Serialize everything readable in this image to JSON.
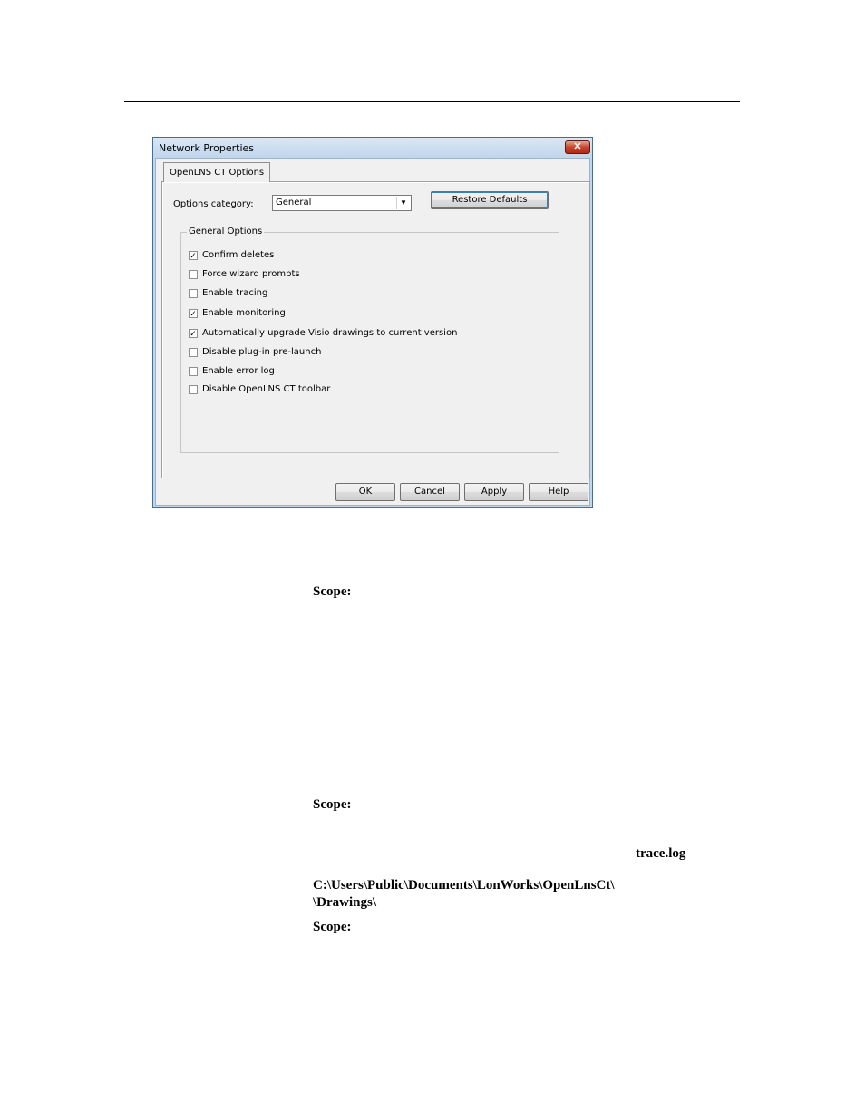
{
  "dialog": {
    "title": "Network Properties",
    "close_symbol": "✕",
    "tab_label": "OpenLNS CT Options",
    "options_category_label": "Options category:",
    "options_category_value": "General",
    "dropdown_arrow": "▼",
    "restore_defaults_label": "Restore Defaults",
    "group_title": "General Options",
    "checkboxes": [
      {
        "label": "Confirm deletes",
        "checked": true,
        "mark": "✓"
      },
      {
        "label": "Force wizard prompts",
        "checked": false,
        "mark": ""
      },
      {
        "label": "Enable tracing",
        "checked": false,
        "mark": ""
      },
      {
        "label": "Enable monitoring",
        "checked": true,
        "mark": "✓"
      },
      {
        "label": "Automatically upgrade Visio drawings to current version",
        "checked": true,
        "mark": "✓"
      },
      {
        "label": "Disable plug-in pre-launch",
        "checked": false,
        "mark": ""
      },
      {
        "label": "Enable error log",
        "checked": false,
        "mark": ""
      },
      {
        "label": "Disable OpenLNS CT toolbar",
        "checked": false,
        "mark": ""
      }
    ],
    "buttons": {
      "ok": "OK",
      "cancel": "Cancel",
      "apply": "Apply",
      "help": "Help"
    }
  },
  "document": {
    "scope_1": "Scope:",
    "scope_2": "Scope:",
    "trace_log": "trace.log",
    "path_line_1": "C:\\Users\\Public\\Documents\\LonWorks\\OpenLnsCt\\",
    "path_line_2": "\\Drawings\\",
    "scope_3": "Scope:"
  }
}
